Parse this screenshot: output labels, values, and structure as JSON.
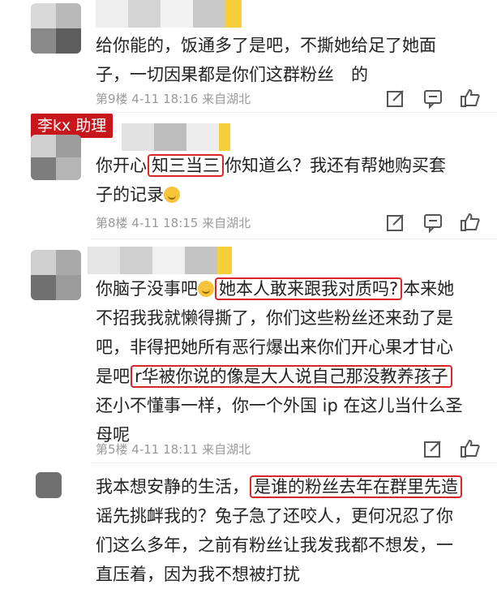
{
  "badge": "李kx 助理",
  "comments": [
    {
      "lines": [
        "给你能的，饭通多了是吧，不撕她给足了她面",
        "子，一切因果都是你们这群粉丝　的"
      ],
      "meta": "第9楼 4-11 18:16 来自湖北"
    },
    {
      "line1_pre": "你开心",
      "line1_hl": "知三当三",
      "line1_post": "你知道么？我还有帮她购买套",
      "line2": "子的记录",
      "meta": "第8楼 4-11 18:15 来自湖北"
    },
    {
      "l1_pre": "你脑子没事吧",
      "l1_hl": "她本人敢来跟我对质吗?",
      "l1_post": "本来她",
      "l2": "不招我我就懒得撕了，你们这些粉丝还来劲了是",
      "l3": "吧，非得把她所有恶行爆出来你们开心果才甘心",
      "l4_pre": "是吧",
      "l4_hl": "r华被你说的像是大人说自己那没教养孩子",
      "l5": "还小不懂事一样，你一个外国 ip 在这儿当什么圣",
      "l6": "母呢",
      "meta": "第5楼 4-11 18:11 来自湖北"
    },
    {
      "l1_pre": "我本想安静的生活，",
      "l1_hl": "是谁的粉丝去年在群里先造",
      "l2": "谣先挑衅我的？兔子急了还咬人，更何况忍了你",
      "l3": "们这么多年，之前有粉丝让我发我都不想发，一",
      "l4": "直压着，因为我不想被打扰"
    }
  ],
  "icons": [
    "edit-icon",
    "comment-icon",
    "thumbs-up-icon"
  ],
  "colors": {
    "highlight": "#d8262b",
    "badge": "#c8161d",
    "meta": "#9a9a9a"
  }
}
